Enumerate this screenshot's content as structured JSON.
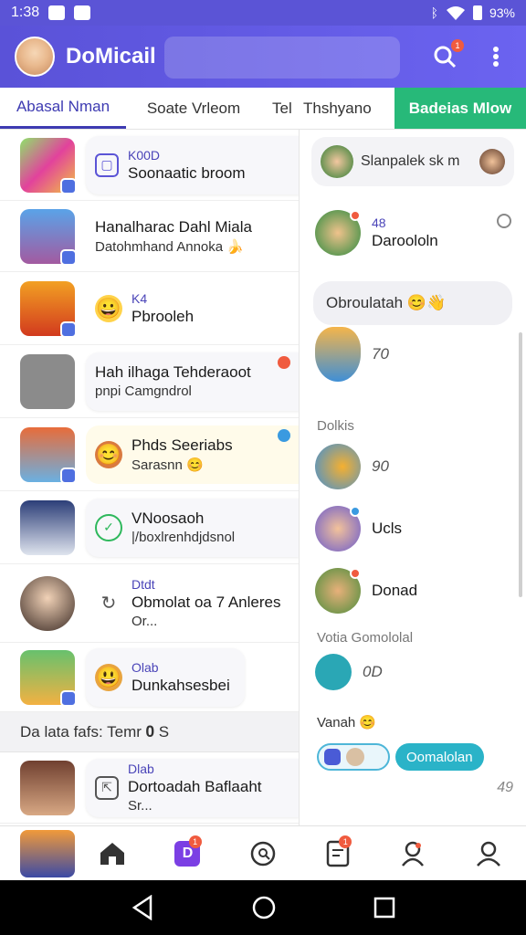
{
  "status_bar": {
    "time": "1:38",
    "battery": "93%"
  },
  "app_bar": {
    "title": "DoMicail",
    "search_badge": "1"
  },
  "tabs": [
    {
      "label": "Abasal Nman"
    },
    {
      "label": "Soate Vrleom"
    },
    {
      "label": "Tel"
    },
    {
      "label": "Thshyano"
    },
    {
      "label": "Badeias Mlow"
    }
  ],
  "left_list": {
    "rows": [
      {
        "small": "K00D",
        "name": "Soonaatic broom",
        "sub": ""
      },
      {
        "small": "",
        "name": "Hanalharac Dahl Miala",
        "sub": "Datohmhand Annoka 🍌"
      },
      {
        "small": "K4",
        "name": "Pbrooleh",
        "sub": ""
      },
      {
        "small": "",
        "name": "Hah ilhaga Tehderaoot",
        "sub": "pnpi Camgndrol"
      },
      {
        "small": "",
        "name": "Phds Seeriabs",
        "sub": "Sarasnn 😊"
      },
      {
        "small": "",
        "name": "VNoosaoh",
        "sub": "|/boxlrenhdjdsnol"
      },
      {
        "small": "Dtdt",
        "name": "Obmolat oa 7 Anleres",
        "sub": "Or..."
      },
      {
        "small": "Olab",
        "name": "Dunkahsesbei",
        "sub": ""
      }
    ],
    "section_header": "Da lata fafs: Temr 𝟎 S",
    "after_section_row": {
      "small": "Dlab",
      "name": "Dortoadah Baflaaht",
      "sub": "Sr..."
    }
  },
  "right_panel": {
    "search_label": "Slanpalek sk m",
    "items": [
      {
        "num": "48",
        "label": "Daroololn"
      },
      {
        "num": "",
        "label": "Ucls"
      },
      {
        "num": "",
        "label": "Donad"
      }
    ],
    "bubble_text": "Obroulatah 😊👋",
    "value_1": "70",
    "section_1": "Dolkis",
    "value_2": "90",
    "section_2": "Votia  Gomololal",
    "value_3": "0D",
    "section_3": "Vanah 😊",
    "pill_label": "Oomalolan",
    "count": "49"
  },
  "bottom_nav": {
    "badge_2": "1",
    "badge_4": "1"
  },
  "icons": {
    "statusbar_left": [
      "sms-icon",
      "notification-icon"
    ],
    "statusbar_right": [
      "bluetooth-icon",
      "wifi-icon",
      "battery-icon"
    ],
    "appbar": [
      "search-icon",
      "more-vert-icon"
    ],
    "bottom_nav": [
      "home-icon",
      "d-app-icon",
      "chat-search-icon",
      "document-icon",
      "location-person-icon",
      "profile-icon"
    ],
    "system_nav": [
      "back-icon",
      "home-circle-icon",
      "recents-icon"
    ]
  },
  "colors": {
    "accent": "#5b54d6",
    "green_tab": "#27b979",
    "badge_red": "#f05b3f"
  }
}
